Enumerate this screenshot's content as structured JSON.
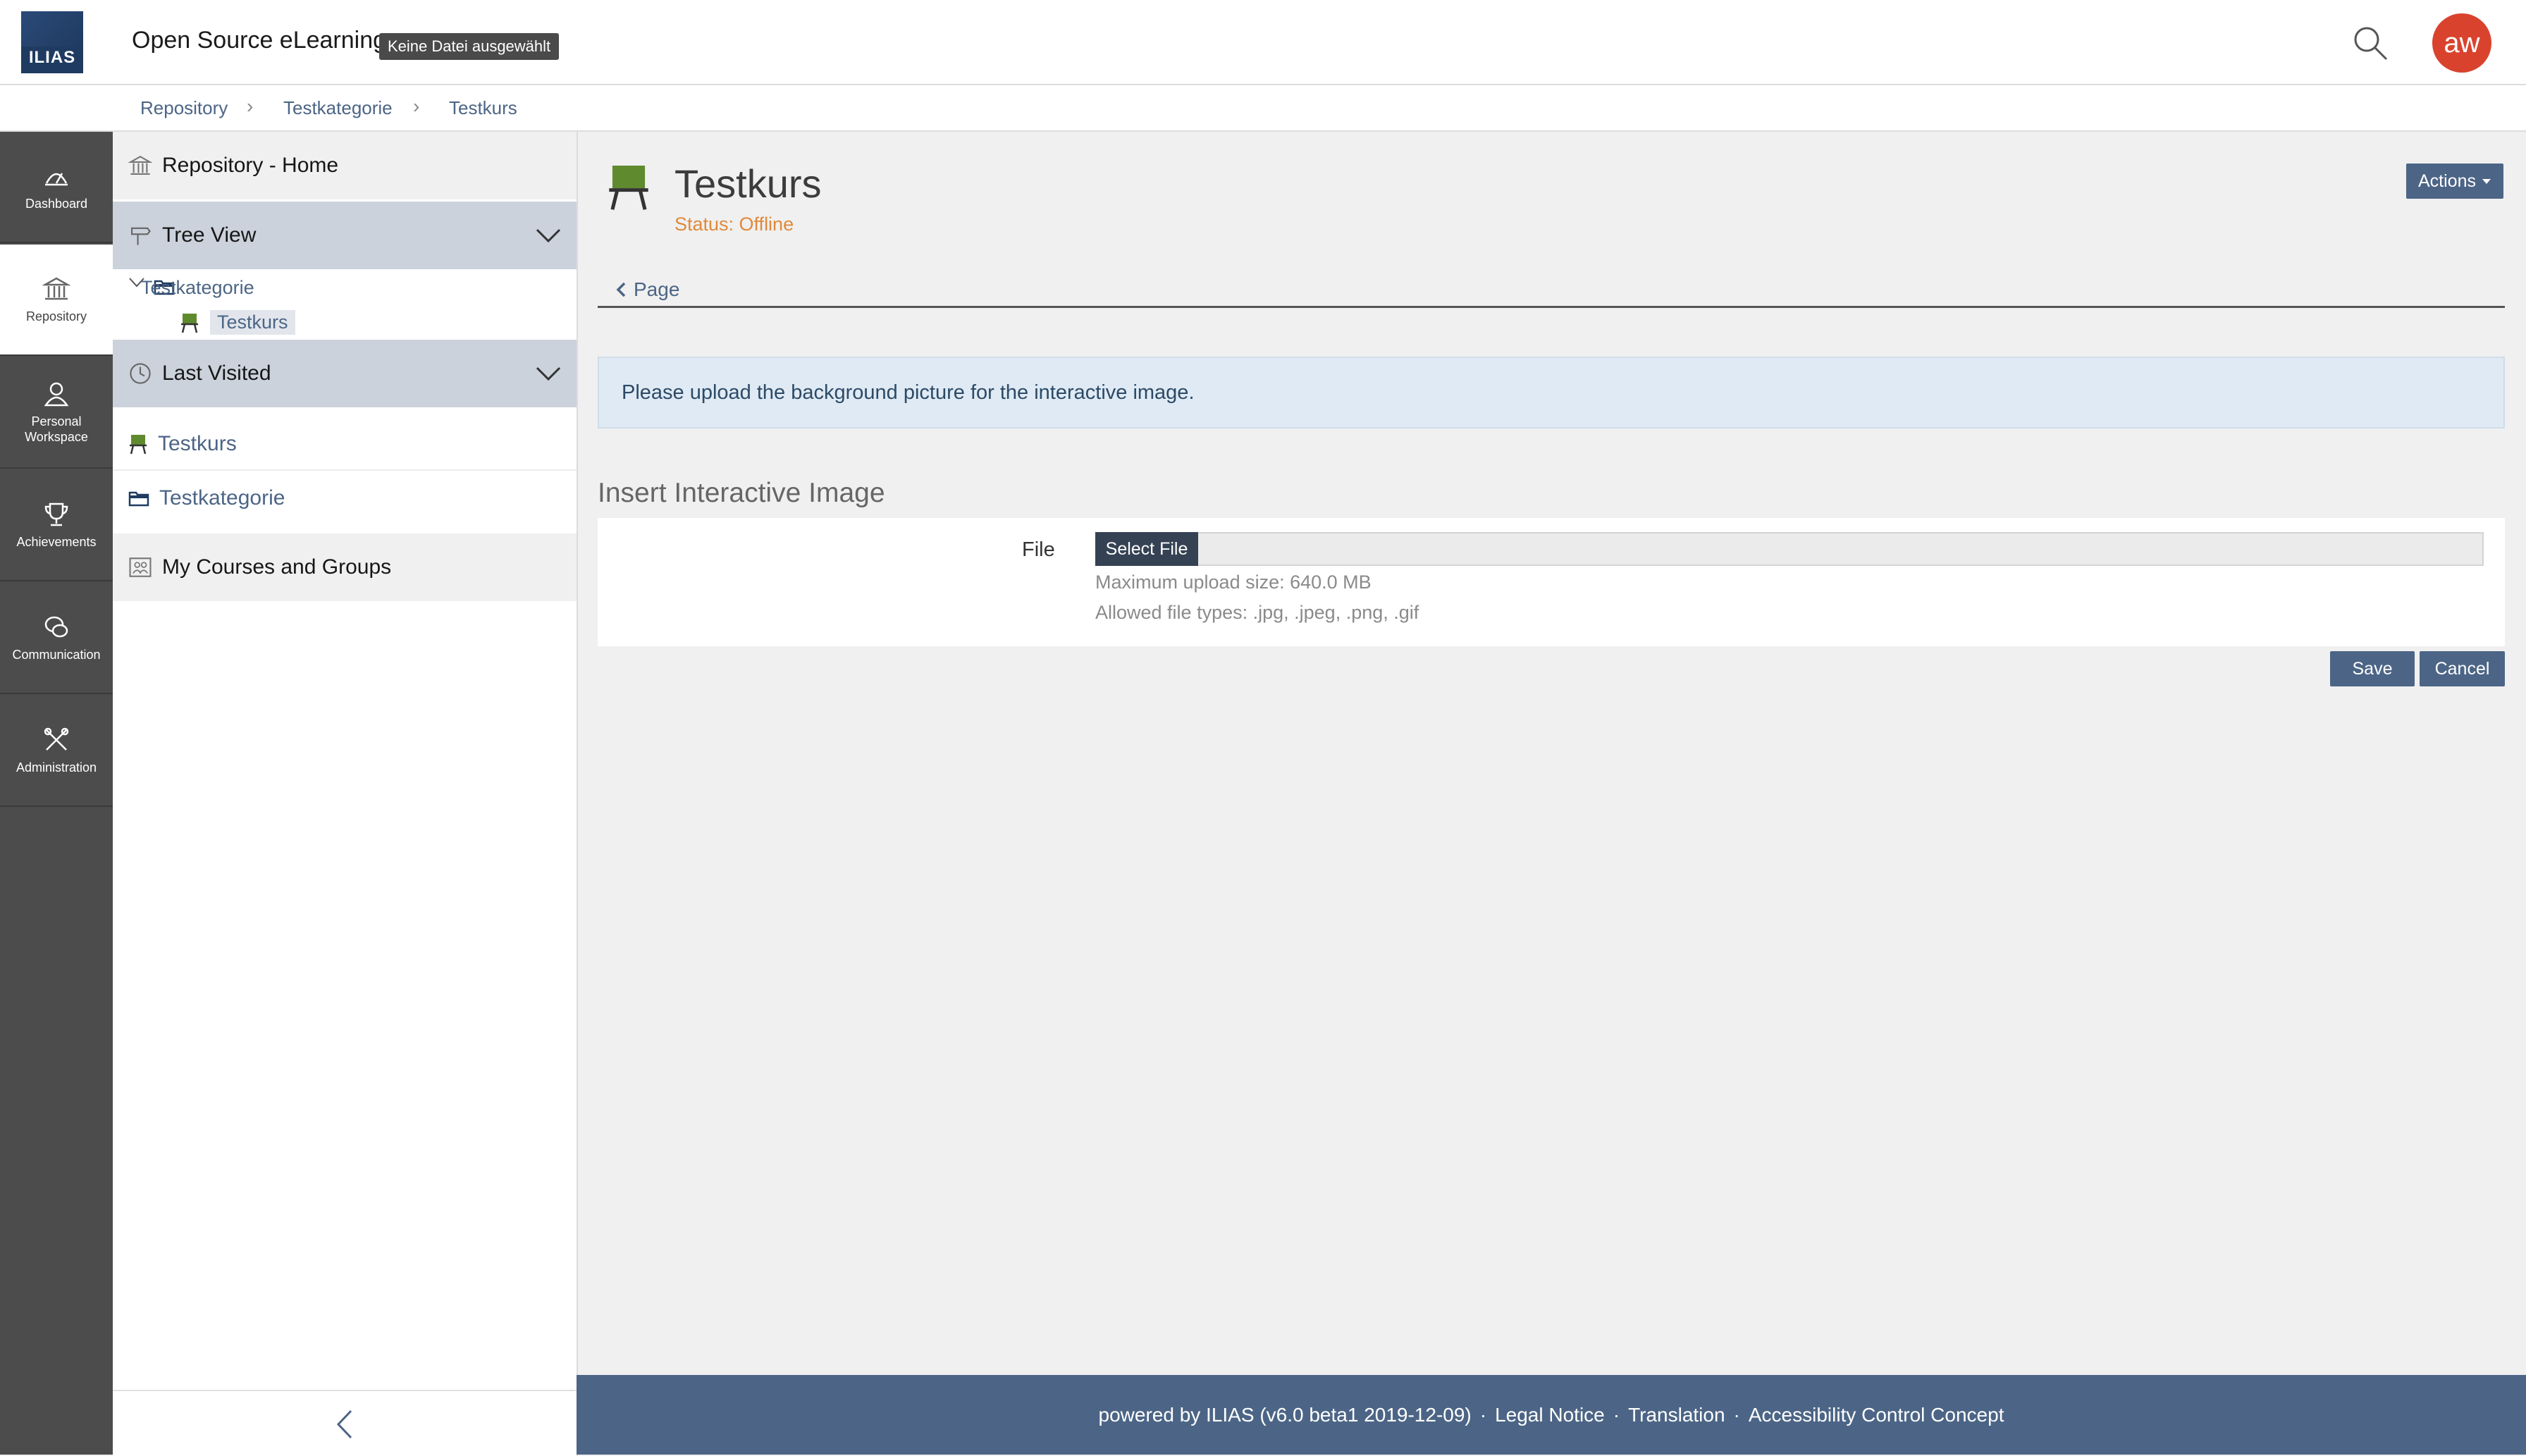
{
  "header": {
    "logo_text": "ILIAS",
    "app_title": "Open Source eLearning",
    "tooltip": "Keine Datei ausgewählt",
    "avatar_initials": "aw"
  },
  "breadcrumb": {
    "items": [
      "Repository",
      "Testkategorie",
      "Testkurs"
    ]
  },
  "mainbar": {
    "items": [
      {
        "label": "Dashboard",
        "icon": "dashboard-icon"
      },
      {
        "label": "Repository",
        "icon": "repository-icon"
      },
      {
        "label": "Personal Workspace",
        "icon": "person-icon"
      },
      {
        "label": "Achievements",
        "icon": "trophy-icon"
      },
      {
        "label": "Communication",
        "icon": "chat-icon"
      },
      {
        "label": "Administration",
        "icon": "tools-icon"
      }
    ]
  },
  "slate": {
    "repo_home": "Repository - Home",
    "tree_view": "Tree View",
    "tree": [
      "Testkategorie",
      "Testkurs"
    ],
    "last_visited": "Last Visited",
    "last_visited_items": [
      "Testkurs",
      "Testkategorie"
    ],
    "my_courses": "My Courses and Groups"
  },
  "content": {
    "title": "Testkurs",
    "status": "Status: Offline",
    "actions_label": "Actions",
    "back_tab": "Page",
    "info_message": "Please upload the background picture for the interactive image.",
    "form_title": "Insert Interactive Image",
    "file_label": "File",
    "select_file": "Select File",
    "max_upload": "Maximum upload size: 640.0 MB",
    "allowed_types": "Allowed file types: .jpg, .jpeg, .png, .gif",
    "save": "Save",
    "cancel": "Cancel"
  },
  "footer": {
    "powered": "powered by ILIAS (v6.0 beta1 2019-12-09)",
    "legal": "Legal Notice",
    "translation": "Translation",
    "accessibility": "Accessibility Control Concept",
    "separator": "·"
  },
  "colors": {
    "brand": "#4c6586",
    "mainbar": "#4c4c4c",
    "avatar": "#d9432e",
    "status_offline": "#e08a3c",
    "info_bg": "#dfeaf4"
  }
}
